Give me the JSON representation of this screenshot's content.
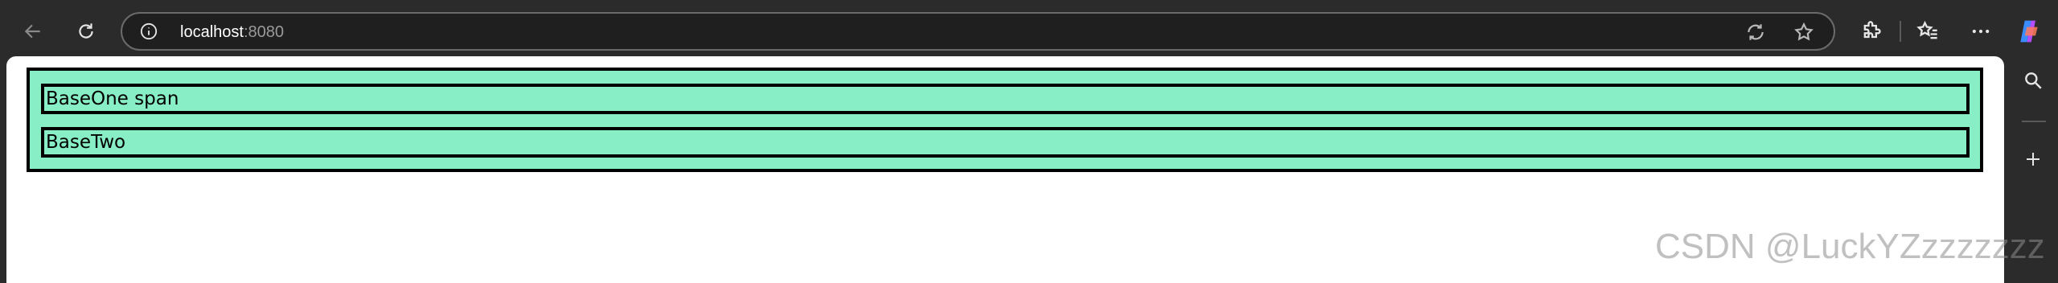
{
  "browser": {
    "url_host": "localhost",
    "url_port": ":8080"
  },
  "page": {
    "blocks": [
      {
        "text": "BaseOne span"
      },
      {
        "text": "BaseTwo"
      }
    ],
    "colors": {
      "box_fill": "#87eec5",
      "border": "#000000"
    }
  },
  "watermark": "CSDN @LuckYZzzzzzzz",
  "icons": {
    "back": "back-arrow-icon",
    "refresh": "refresh-icon",
    "site_info": "info-icon",
    "immersive_reader": "immersive-reader-icon",
    "favorite": "star-icon",
    "extensions": "puzzle-icon",
    "favorites_list": "favorites-list-icon",
    "more": "more-icon",
    "copilot": "copilot-icon",
    "search": "search-icon",
    "add": "plus-icon"
  }
}
